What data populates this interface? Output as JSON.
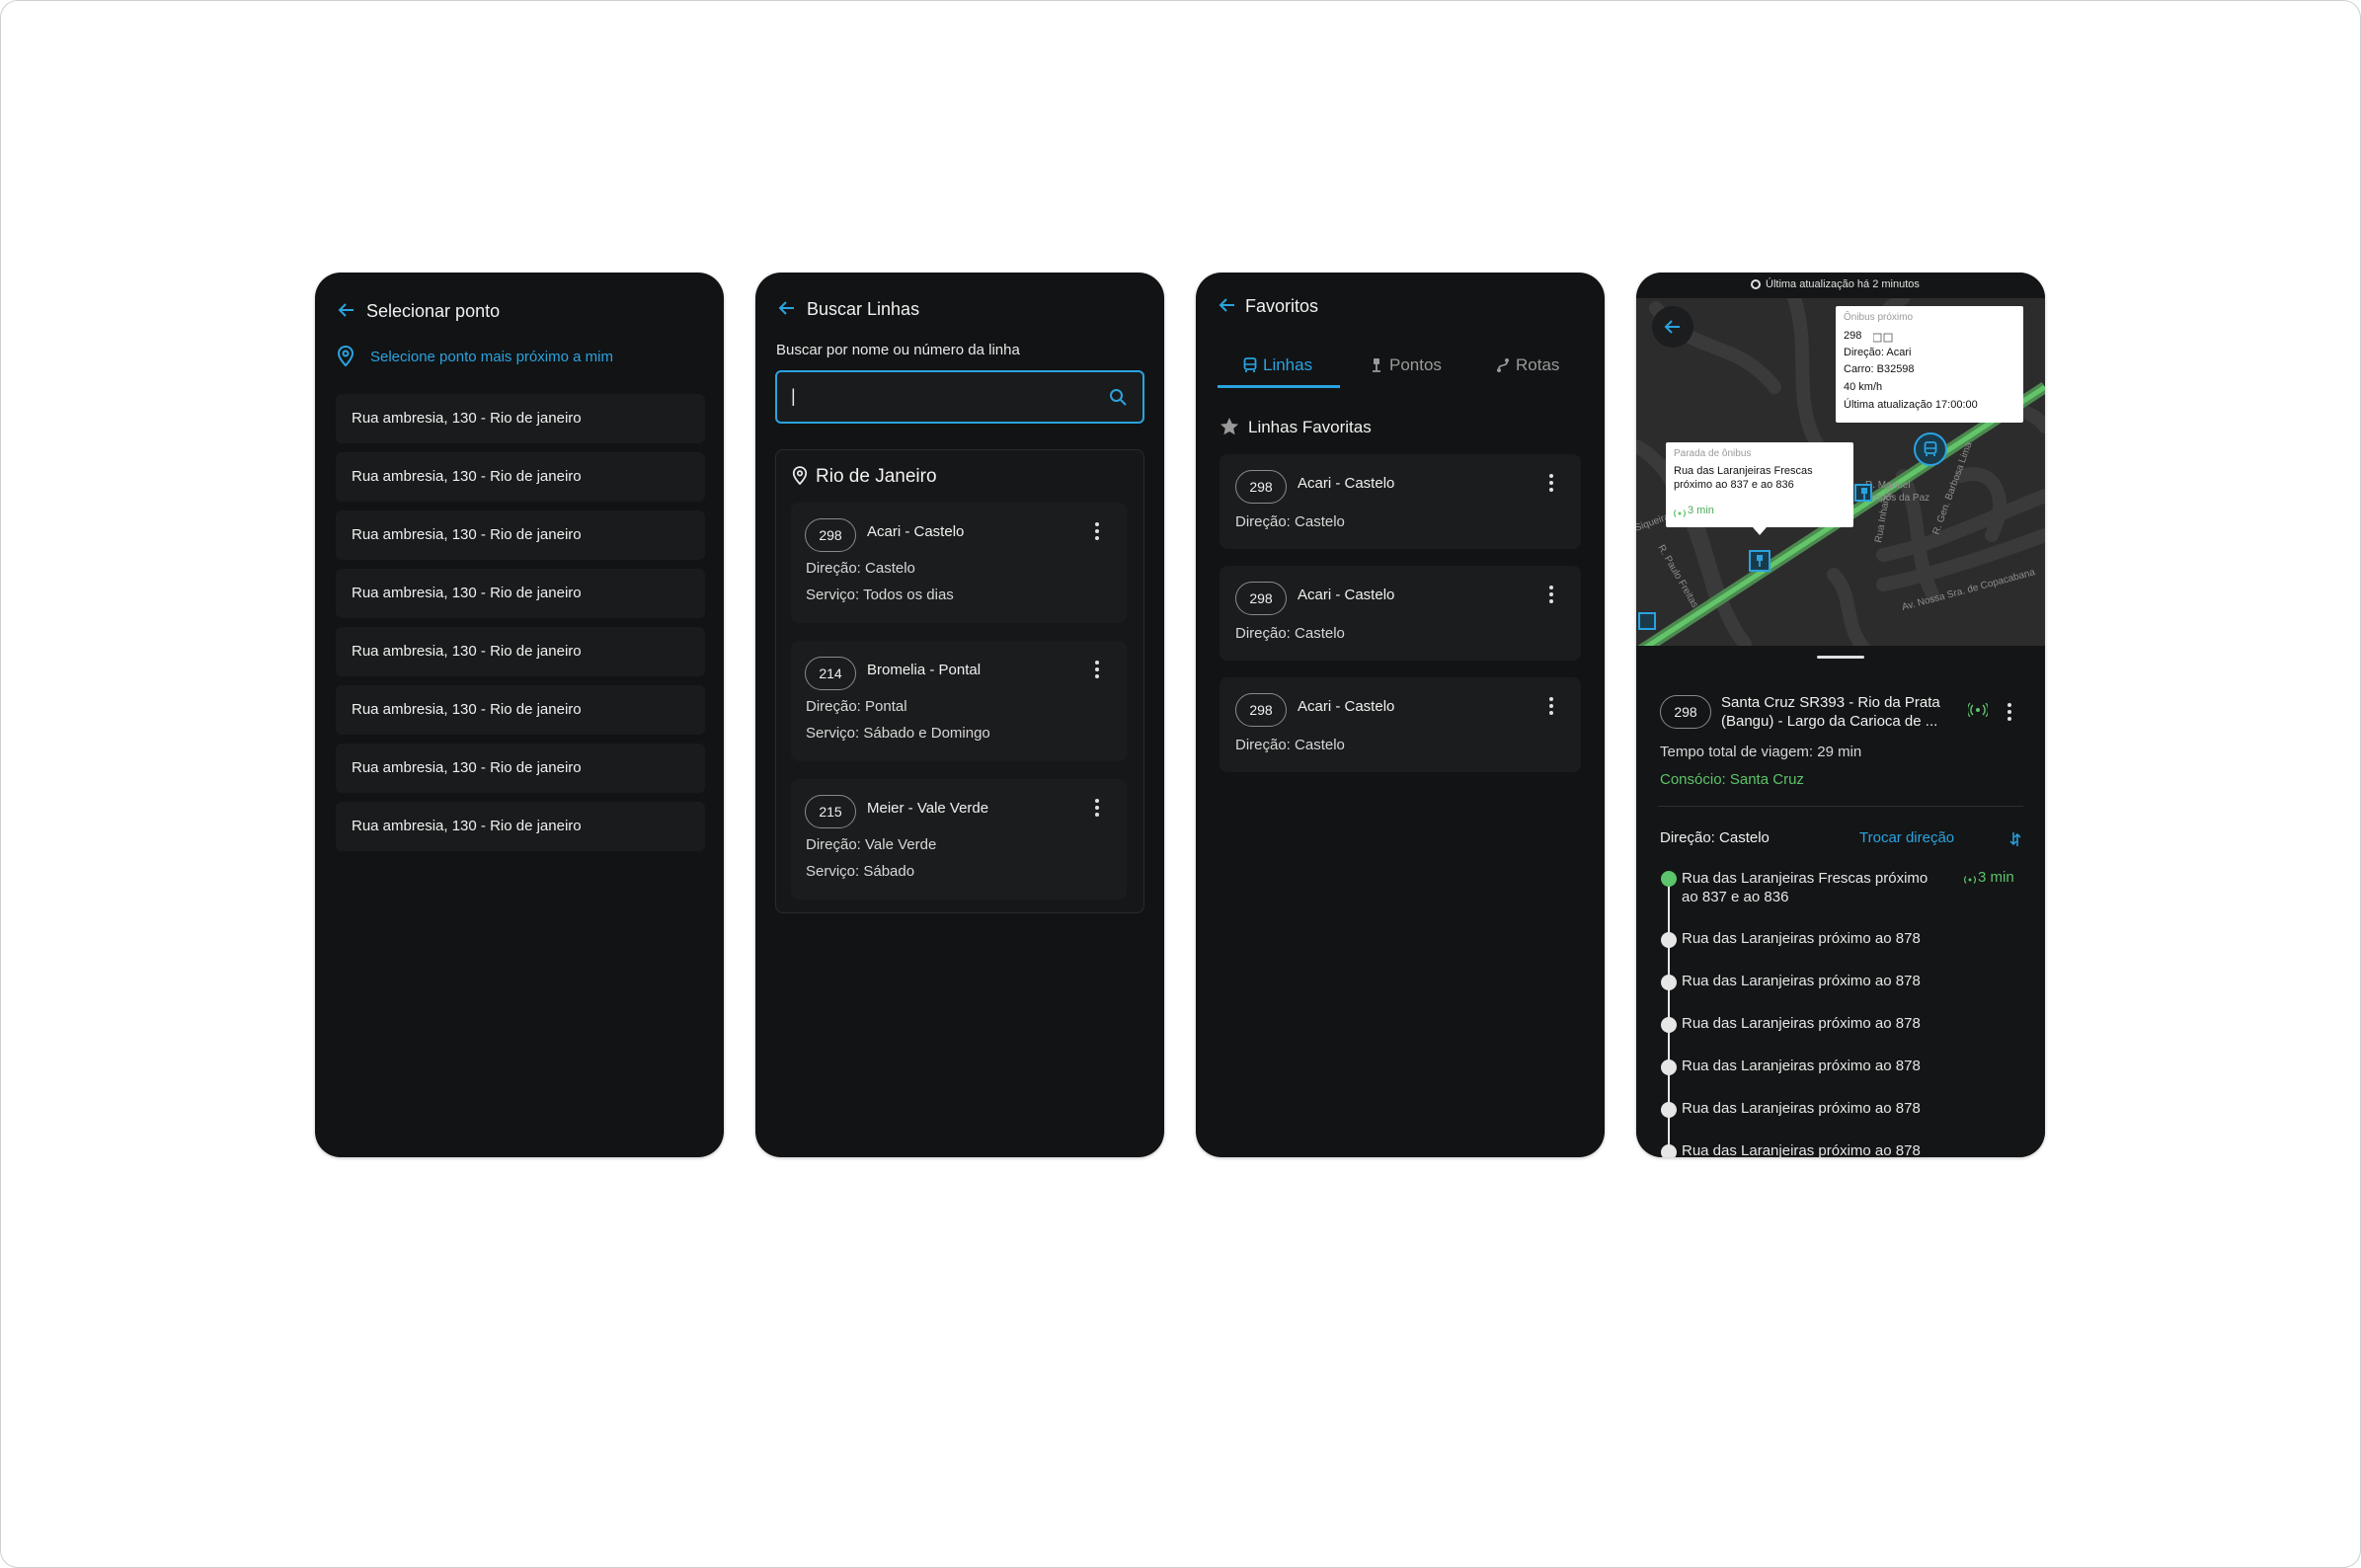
{
  "screen1": {
    "title": "Selecionar ponto",
    "nearest_label": "Selecione ponto mais próximo a mim",
    "items": [
      "Rua ambresia, 130 - Rio de janeiro",
      "Rua ambresia, 130 - Rio de janeiro",
      "Rua ambresia, 130 - Rio de janeiro",
      "Rua ambresia, 130 - Rio de janeiro",
      "Rua ambresia, 130 - Rio de janeiro",
      "Rua ambresia, 130 - Rio de janeiro",
      "Rua ambresia, 130 - Rio de janeiro",
      "Rua ambresia, 130 - Rio de janeiro"
    ]
  },
  "screen2": {
    "title": "Buscar Linhas",
    "search_label": "Buscar por nome ou número da linha",
    "search_value": "|",
    "city": "Rio de Janeiro",
    "lines": [
      {
        "number": "298",
        "name": "Acari - Castelo",
        "direction": "Direção: Castelo",
        "service": "Serviço: Todos os dias"
      },
      {
        "number": "214",
        "name": "Bromelia - Pontal",
        "direction": "Direção: Pontal",
        "service": "Serviço: Sábado e Domingo"
      },
      {
        "number": "215",
        "name": "Meier - Vale Verde",
        "direction": "Direção: Vale Verde",
        "service": "Serviço: Sábado"
      }
    ]
  },
  "screen3": {
    "title": "Favoritos",
    "tabs": [
      "Linhas",
      "Pontos",
      "Rotas"
    ],
    "section": "Linhas Favoritas",
    "favorites": [
      {
        "number": "298",
        "name": "Acari - Castelo",
        "direction": "Direção: Castelo"
      },
      {
        "number": "298",
        "name": "Acari - Castelo",
        "direction": "Direção: Castelo"
      },
      {
        "number": "298",
        "name": "Acari - Castelo",
        "direction": "Direção: Castelo"
      }
    ]
  },
  "screen4": {
    "update_banner": "Última atualização há 2 minutos",
    "bus_popup": {
      "title": "Ônibus próximo",
      "line": "298",
      "direction": "Direção: Acari",
      "car": "Carro: B32598",
      "speed": "40 km/h",
      "updated": "Última atualização 17:00:00"
    },
    "stop_popup": {
      "title": "Parada de ônibus",
      "name": "Rua das Laranjeiras Frescas próximo ao 837 e ao 836",
      "eta": "3 min"
    },
    "map_labels": [
      "R. Paulo Freitas",
      "R. Manuel",
      "Campos da Paz",
      "Rua Inhanga",
      "R. Gen. Barbosa Lima",
      "Av. Nossa Sra. de Copacabana",
      "Siqueira"
    ],
    "line_number": "298",
    "line_name": "Santa Cruz SR393 - Rio da Prata (Bangu) - Largo da Carioca de ...",
    "total_time": "Tempo total de viagem: 29 min",
    "consortium": "Consócio: Santa Cruz",
    "direction": "Direção: Castelo",
    "swap_label": "Trocar direção",
    "stops": [
      {
        "name": "Rua das Laranjeiras Frescas próximo ao 837 e ao 836",
        "eta": "3 min"
      },
      {
        "name": "Rua das Laranjeiras próximo ao 878"
      },
      {
        "name": "Rua das Laranjeiras próximo ao 878"
      },
      {
        "name": "Rua das Laranjeiras próximo ao 878"
      },
      {
        "name": "Rua das Laranjeiras próximo ao 878"
      },
      {
        "name": "Rua das Laranjeiras próximo ao 878"
      },
      {
        "name": "Rua das Laranjeiras próximo ao 878"
      }
    ],
    "colors": {
      "accent": "#2aa3e0",
      "live": "#5cc46a",
      "route": "#58c463"
    }
  }
}
